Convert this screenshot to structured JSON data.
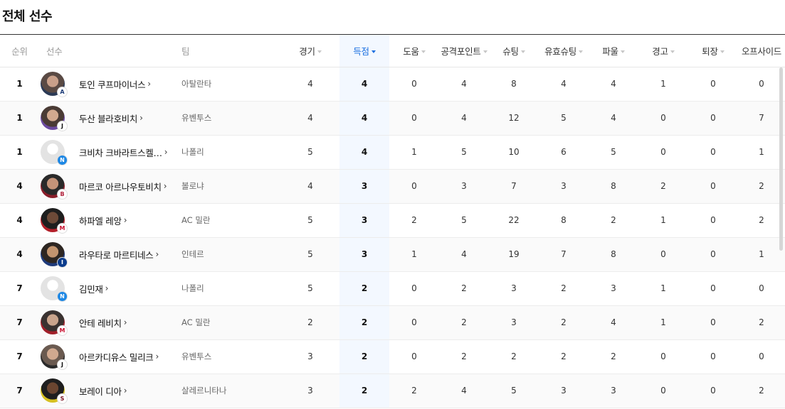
{
  "page": {
    "title": "전체 선수"
  },
  "table": {
    "headers": {
      "rank": "순위",
      "player": "선수",
      "team": "팀",
      "apps": "경기",
      "goals": "득점",
      "assists": "도움",
      "points": "공격포인트",
      "shots": "슈팅",
      "shots_on_target": "유효슈팅",
      "fouls": "파울",
      "yellow": "경고",
      "red": "퇴장",
      "offside": "오프사이드"
    },
    "colors": {
      "accent": "#1a6fe0",
      "highlight_bg": "#f3f8ff"
    },
    "rows": [
      {
        "rank": "1",
        "name": "토인 쿠프마이너스",
        "team": "아탈란타",
        "apps": "4",
        "goals": "4",
        "assists": "0",
        "points": "4",
        "shots": "8",
        "sot": "4",
        "fouls": "4",
        "yellow": "1",
        "red": "0",
        "offside": "0",
        "avatar": "photo",
        "club_icon": "atalanta-crest-icon"
      },
      {
        "rank": "1",
        "name": "두산 블라호비치",
        "team": "유벤투스",
        "apps": "4",
        "goals": "4",
        "assists": "0",
        "points": "4",
        "shots": "12",
        "sot": "5",
        "fouls": "4",
        "yellow": "0",
        "red": "0",
        "offside": "7",
        "avatar": "photo",
        "club_icon": "juventus-crest-icon"
      },
      {
        "rank": "1",
        "name": "크비차 크바라트스켈…",
        "team": "나폴리",
        "apps": "5",
        "goals": "4",
        "assists": "1",
        "points": "5",
        "shots": "10",
        "sot": "6",
        "fouls": "5",
        "yellow": "0",
        "red": "0",
        "offside": "1",
        "avatar": "placeholder",
        "club_icon": "napoli-crest-icon"
      },
      {
        "rank": "4",
        "name": "마르코 아르나우토비치",
        "team": "볼로냐",
        "apps": "4",
        "goals": "3",
        "assists": "0",
        "points": "3",
        "shots": "7",
        "sot": "3",
        "fouls": "8",
        "yellow": "2",
        "red": "0",
        "offside": "2",
        "avatar": "photo",
        "club_icon": "bologna-crest-icon"
      },
      {
        "rank": "4",
        "name": "하파엘 레앙",
        "team": "AC 밀란",
        "apps": "5",
        "goals": "3",
        "assists": "2",
        "points": "5",
        "shots": "22",
        "sot": "8",
        "fouls": "2",
        "yellow": "1",
        "red": "0",
        "offside": "2",
        "avatar": "photo",
        "club_icon": "milan-crest-icon"
      },
      {
        "rank": "4",
        "name": "라우타로 마르티네스",
        "team": "인테르",
        "apps": "5",
        "goals": "3",
        "assists": "1",
        "points": "4",
        "shots": "19",
        "sot": "7",
        "fouls": "8",
        "yellow": "0",
        "red": "0",
        "offside": "1",
        "avatar": "photo",
        "club_icon": "inter-crest-icon"
      },
      {
        "rank": "7",
        "name": "김민재",
        "team": "나폴리",
        "apps": "5",
        "goals": "2",
        "assists": "0",
        "points": "2",
        "shots": "3",
        "sot": "2",
        "fouls": "3",
        "yellow": "1",
        "red": "0",
        "offside": "0",
        "avatar": "placeholder",
        "club_icon": "napoli-crest-icon"
      },
      {
        "rank": "7",
        "name": "안테 레비치",
        "team": "AC 밀란",
        "apps": "2",
        "goals": "2",
        "assists": "0",
        "points": "2",
        "shots": "3",
        "sot": "2",
        "fouls": "4",
        "yellow": "1",
        "red": "0",
        "offside": "2",
        "avatar": "photo",
        "club_icon": "milan-crest-icon"
      },
      {
        "rank": "7",
        "name": "아르카디유스 밀리크",
        "team": "유벤투스",
        "apps": "3",
        "goals": "2",
        "assists": "0",
        "points": "2",
        "shots": "2",
        "sot": "2",
        "fouls": "2",
        "yellow": "0",
        "red": "0",
        "offside": "0",
        "avatar": "photo",
        "club_icon": "juventus-crest-icon"
      },
      {
        "rank": "7",
        "name": "보레이 디아",
        "team": "살레르니타나",
        "apps": "3",
        "goals": "2",
        "assists": "2",
        "points": "4",
        "shots": "5",
        "sot": "3",
        "fouls": "3",
        "yellow": "0",
        "red": "0",
        "offside": "2",
        "avatar": "photo",
        "club_icon": "salernitana-crest-icon"
      }
    ]
  }
}
